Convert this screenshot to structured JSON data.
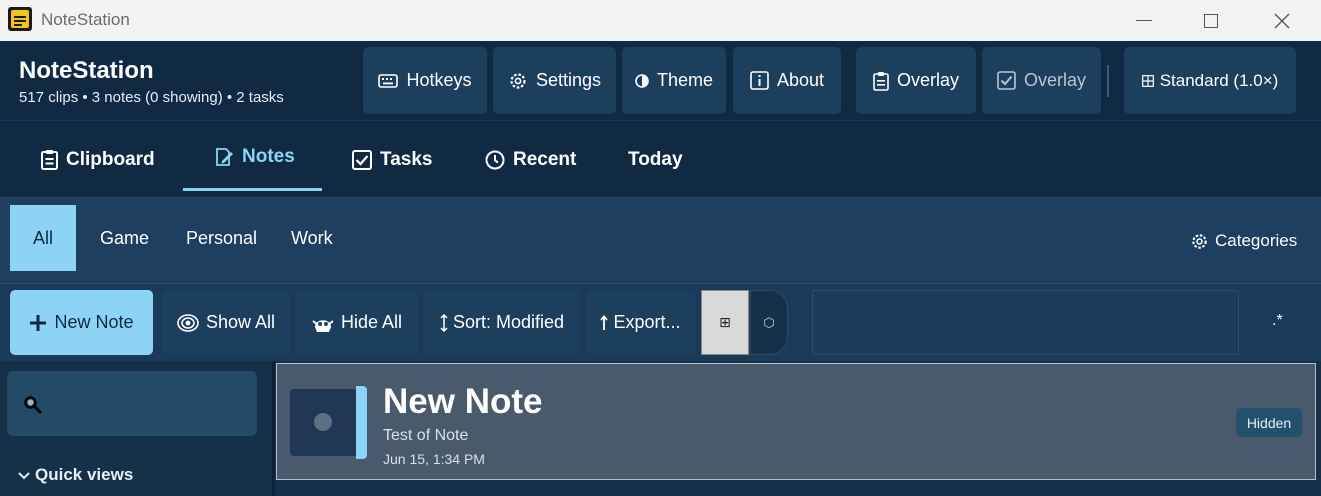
{
  "window": {
    "title": "NoteStation"
  },
  "header": {
    "app_name": "NoteStation",
    "stats": "517 clips • 3 notes (0 showing) • 2 tasks",
    "buttons": {
      "hotkeys": "Hotkeys",
      "settings": "Settings",
      "theme": "Theme",
      "about": "About",
      "overlay_note": "Overlay",
      "overlay_check": "Overlay",
      "standard": "Standard (1.0×)"
    }
  },
  "tabs": {
    "clipboard": "Clipboard",
    "notes": "Notes",
    "tasks": "Tasks",
    "recent": "Recent",
    "today": "Today",
    "active": "Notes"
  },
  "categories": {
    "items": [
      "All",
      "Game",
      "Personal",
      "Work"
    ],
    "active": "All",
    "manage_label": "Categories"
  },
  "toolbar": {
    "new_note": "New Note",
    "show_all": "Show All",
    "hide_all": "Hide All",
    "sort": "Sort: Modified",
    "export": "Export...",
    "grid_glyph": "⊞",
    "hex_glyph": "⬡",
    "search_value": "",
    "regex_label": ".*"
  },
  "sidebar": {
    "search_value": "",
    "quick_views_label": "Quick views"
  },
  "notes": [
    {
      "title": "New Note",
      "content": "Test of Note",
      "date": "Jun 15, 1:34 PM",
      "status": "Hidden"
    }
  ],
  "colors": {
    "accent": "#8dd3f5",
    "header_bg": "#102a43",
    "button_bg": "#1d3f5e",
    "card_bg": "#485a6b"
  },
  "icons": {
    "keyboard": "keyboard-icon",
    "settings": "gear-icon",
    "theme": "half-circle-icon",
    "about": "info-icon",
    "overlay_note": "clipboard-icon",
    "overlay_check": "checkbox-icon",
    "standard": "grid-icon"
  }
}
